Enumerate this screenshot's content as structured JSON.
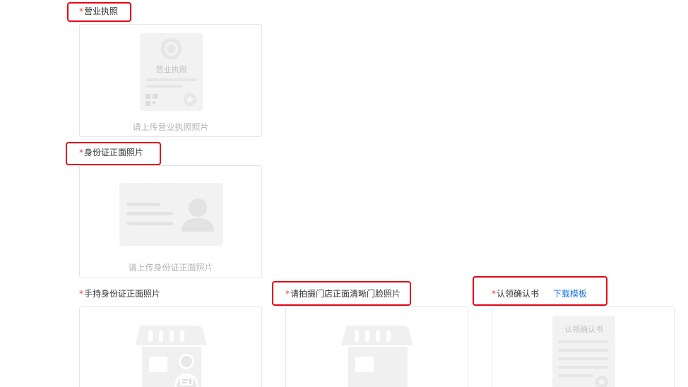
{
  "fields": {
    "business_license": {
      "required_mark": "*",
      "label": "营业执照",
      "illustration_text": "营业执照",
      "hint": "请上传营业执照照片"
    },
    "id_front": {
      "required_mark": "*",
      "label": "身份证正面照片",
      "hint": "请上传身份证正面照片"
    },
    "handheld_id": {
      "required_mark": "*",
      "label": "手持身份证正面照片"
    },
    "storefront": {
      "required_mark": "*",
      "label": "请拍摄门店正面清晰门脸照片"
    },
    "claim_letter": {
      "required_mark": "*",
      "label": "认领确认书",
      "download_link": "下载模板",
      "illustration_text": "认领确认书"
    }
  },
  "colors": {
    "required": "#e8402f",
    "link": "#1b74e4",
    "highlight_border": "#e60012",
    "placeholder_gray": "#f2f2f2",
    "card_border": "#e5e5e5",
    "hint_text": "#b3b3b3"
  }
}
